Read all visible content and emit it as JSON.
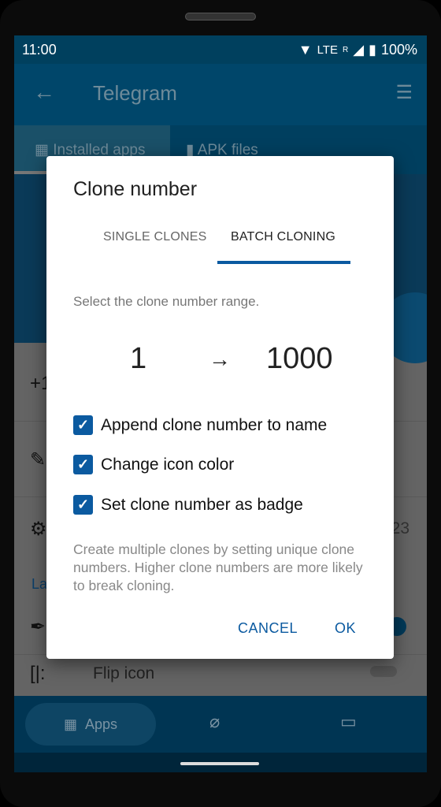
{
  "status": {
    "time": "11:00",
    "network": "LTE",
    "roaming": "R",
    "battery": "100%"
  },
  "appbar": {
    "title": "Telegram",
    "back_icon": "arrow-left-icon",
    "filter_icon": "filter-search-icon"
  },
  "tabs": [
    {
      "label": "Installed apps",
      "icon": "grid-icon"
    },
    {
      "label": "APK files",
      "icon": "file-icon"
    }
  ],
  "rows": {
    "r1": "+1",
    "r3_value": "23",
    "section": "La",
    "flip": "Flip icon"
  },
  "bottom_nav": {
    "apps": "Apps"
  },
  "dialog": {
    "title": "Clone number",
    "tabs": [
      {
        "label": "SINGLE CLONES",
        "active": false
      },
      {
        "label": "BATCH CLONING",
        "active": true
      }
    ],
    "prompt": "Select the clone number range.",
    "range_from": "1",
    "arrow": "→",
    "range_to": "1000",
    "options": [
      {
        "label": "Append clone number to name",
        "checked": true
      },
      {
        "label": "Change icon color",
        "checked": true
      },
      {
        "label": "Set clone number as badge",
        "checked": true
      }
    ],
    "help": "Create multiple clones by setting unique clone numbers. Higher clone numbers are more likely to break cloning.",
    "cancel": "CANCEL",
    "ok": "OK"
  },
  "colors": {
    "accent": "#0b5aa0"
  }
}
